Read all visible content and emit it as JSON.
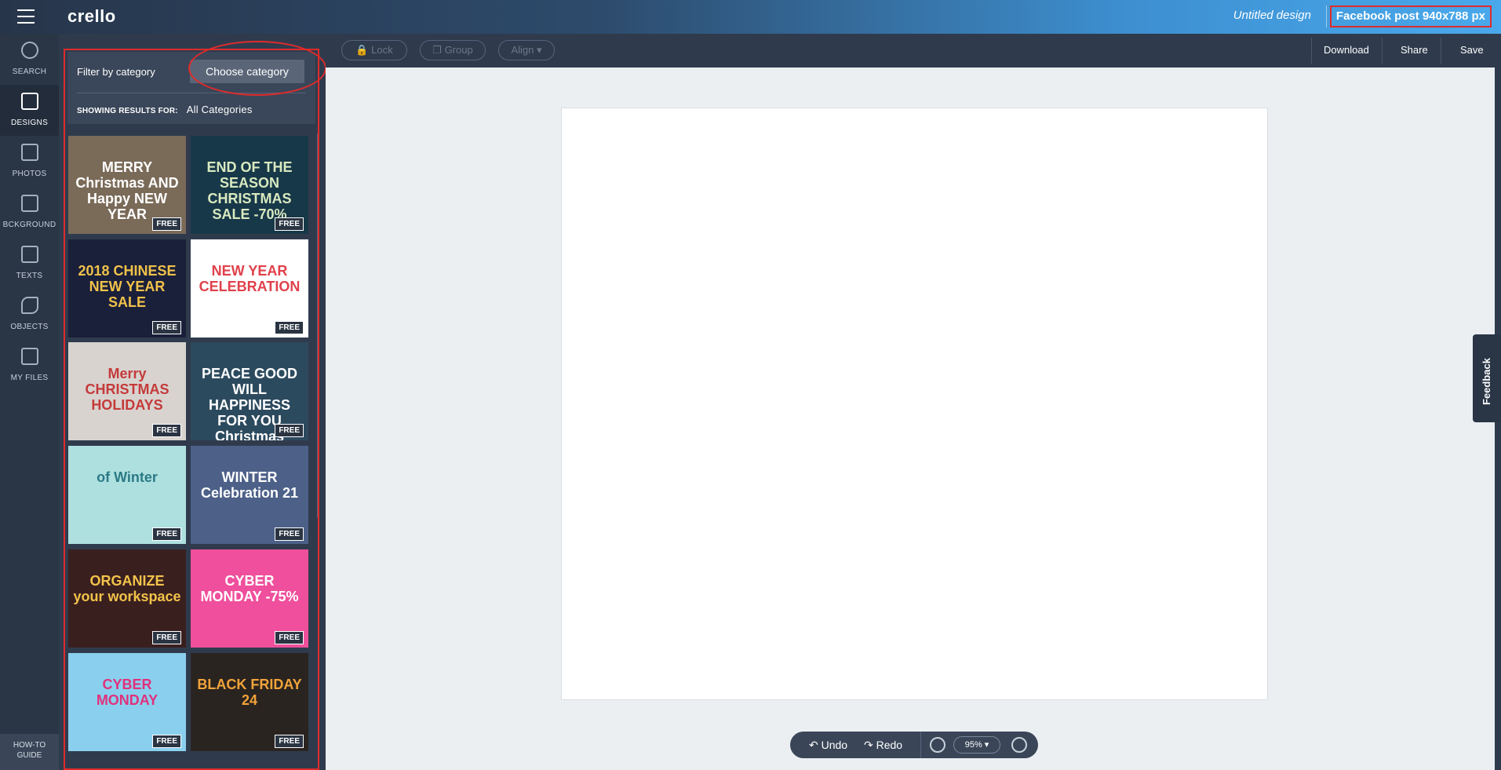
{
  "app": {
    "logo": "crello",
    "design_title": "Untitled design",
    "format": "Facebook post 940x788 px"
  },
  "nav": {
    "items": [
      {
        "label": "SEARCH"
      },
      {
        "label": "DESIGNS"
      },
      {
        "label": "PHOTOS"
      },
      {
        "label": "BCKGROUND"
      },
      {
        "label": "TEXTS"
      },
      {
        "label": "OBJECTS"
      },
      {
        "label": "MY FILES"
      }
    ],
    "howto_line1": "HOW-TO",
    "howto_line2": "GUIDE"
  },
  "panel": {
    "filter_label": "Filter by category",
    "choose_label": "Choose category",
    "showing_label": "SHOWING RESULTS FOR:",
    "showing_value": "All Categories",
    "free_badge": "FREE",
    "thumbs": [
      {
        "text": "MERRY Christmas AND Happy NEW YEAR",
        "bg": "#7a6a58",
        "fg": "#ffffff"
      },
      {
        "text": "END OF THE SEASON CHRISTMAS SALE -70%",
        "bg": "#173848",
        "fg": "#d9e9c0"
      },
      {
        "text": "2018 CHINESE NEW YEAR SALE",
        "bg": "#1a1f3a",
        "fg": "#f0c24a"
      },
      {
        "text": "NEW YEAR CELEBRATION",
        "bg": "#ffffff",
        "fg": "#e0414b"
      },
      {
        "text": "Merry CHRISTMAS HOLIDAYS",
        "bg": "#d8d3cf",
        "fg": "#c43a3a"
      },
      {
        "text": "PEACE GOOD WILL HAPPINESS FOR YOU Christmas",
        "bg": "#2c4a5e",
        "fg": "#ffffff"
      },
      {
        "text": "of Winter",
        "bg": "#aee0e0",
        "fg": "#2b7a85"
      },
      {
        "text": "WINTER Celebration 21",
        "bg": "#4c6088",
        "fg": "#ffffff"
      },
      {
        "text": "ORGANIZE your workspace",
        "bg": "#3a1f1f",
        "fg": "#f2c34a"
      },
      {
        "text": "CYBER MONDAY -75%",
        "bg": "#ef4f9c",
        "fg": "#ffffff"
      },
      {
        "text": "CYBER MONDAY",
        "bg": "#8ad0ee",
        "fg": "#e0317c"
      },
      {
        "text": "BLACK FRIDAY 24",
        "bg": "#2a2420",
        "fg": "#f2a33a"
      }
    ]
  },
  "toolbar": {
    "lock": "Lock",
    "group": "Group",
    "align": "Align ▾",
    "download": "Download",
    "share": "Share",
    "save": "Save"
  },
  "bottom": {
    "undo": "Undo",
    "redo": "Redo",
    "zoom": "95% ▾"
  },
  "feedback": "Feedback"
}
